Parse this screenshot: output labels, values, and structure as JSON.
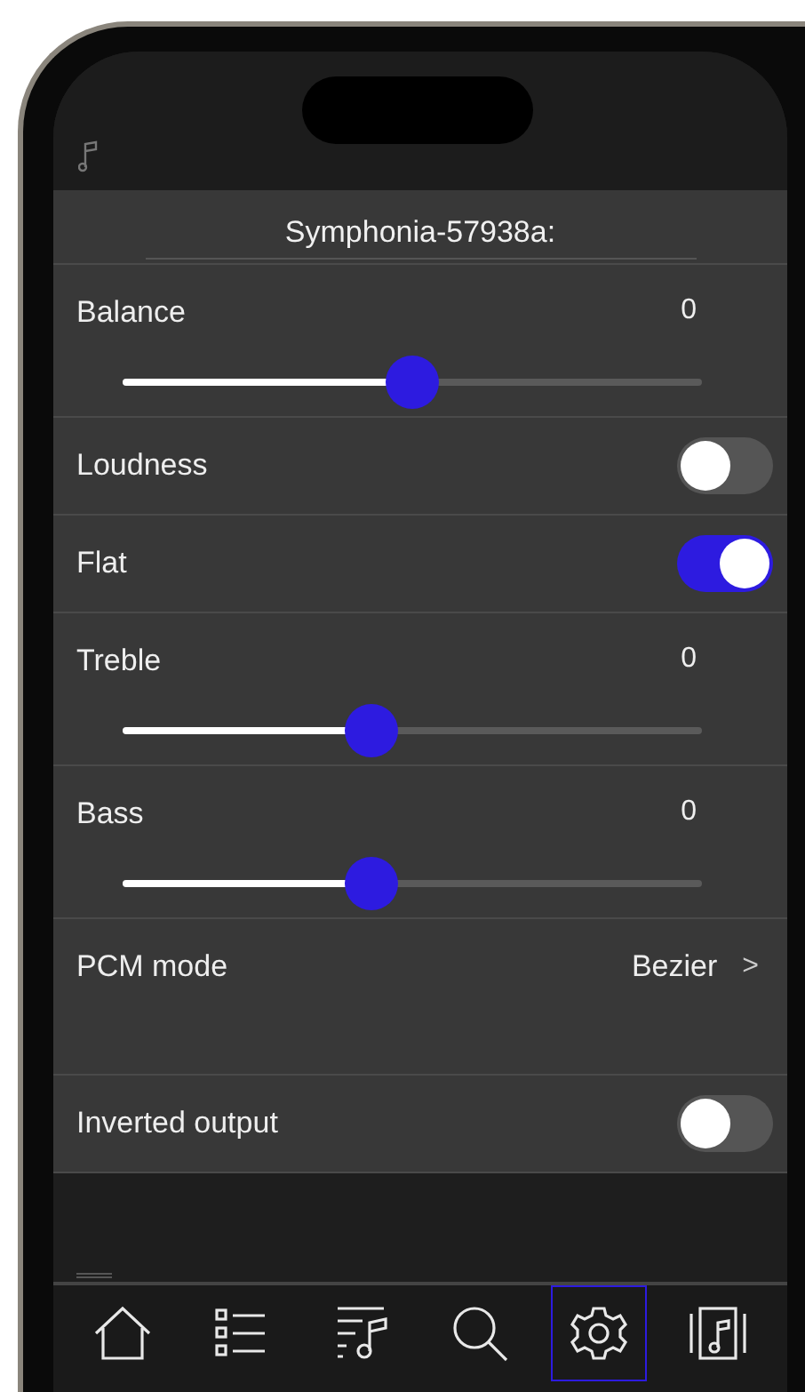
{
  "device_title": "Symphonia-57938a:",
  "settings": [
    {
      "kind": "slider",
      "label": "Balance",
      "value": "0",
      "level": 0.5
    },
    {
      "kind": "toggle",
      "label": "Loudness",
      "on": false
    },
    {
      "kind": "toggle",
      "label": "Flat",
      "on": true
    },
    {
      "kind": "slider",
      "label": "Treble",
      "value": "0",
      "level": 0.43
    },
    {
      "kind": "slider",
      "label": "Bass",
      "value": "0",
      "level": 0.43
    },
    {
      "kind": "nav",
      "label": "PCM mode",
      "value": "Bezier",
      "chevron": ">"
    },
    {
      "kind": "toggle",
      "label": "Inverted output",
      "on": false
    }
  ],
  "tab_bar": [
    {
      "kind": "home",
      "selected": false
    },
    {
      "kind": "list",
      "selected": false
    },
    {
      "kind": "playlist",
      "selected": false
    },
    {
      "kind": "search",
      "selected": false
    },
    {
      "kind": "settings",
      "selected": true
    },
    {
      "kind": "album",
      "selected": false
    }
  ]
}
